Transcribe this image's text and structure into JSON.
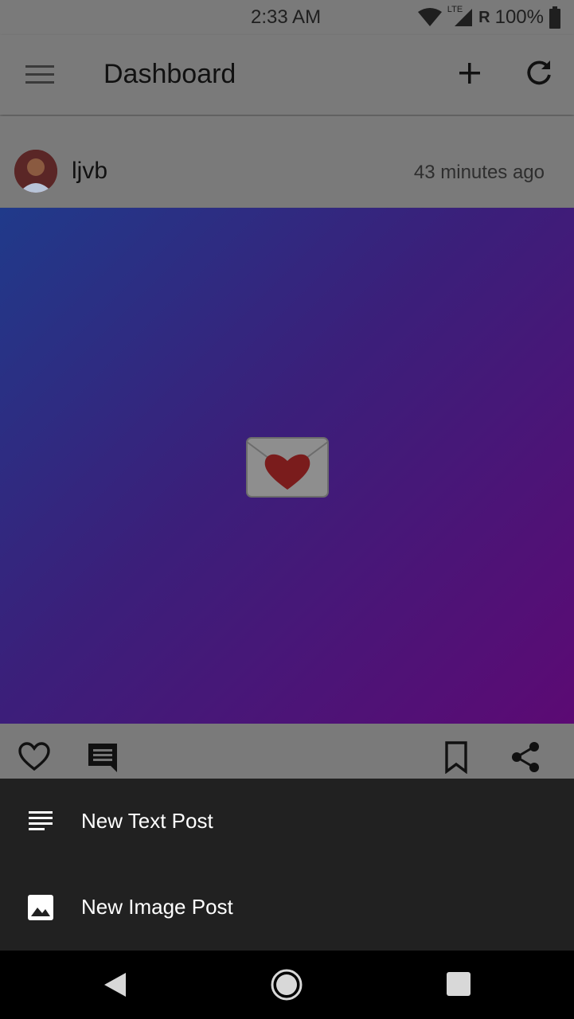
{
  "status_bar": {
    "time": "2:33 AM",
    "network": "LTE",
    "roaming": "R",
    "battery": "100%"
  },
  "app_bar": {
    "title": "Dashboard",
    "icons": [
      "menu-icon",
      "add-icon",
      "refresh-icon"
    ]
  },
  "post": {
    "username": "ljvb",
    "timestamp": "43 minutes ago",
    "image_emoji": "love-letter-icon",
    "gradient_colors": [
      "#203a8a",
      "#3b1f7a",
      "#5c0a74"
    ],
    "actions": [
      "heart-icon",
      "comment-icon",
      "bookmark-icon",
      "share-icon"
    ]
  },
  "sheet": {
    "items": [
      {
        "label": "New Text Post",
        "icon": "text-lines-icon"
      },
      {
        "label": "New Image Post",
        "icon": "image-icon"
      }
    ]
  },
  "nav": {
    "icons": [
      "back-icon",
      "home-icon",
      "recents-icon"
    ]
  }
}
